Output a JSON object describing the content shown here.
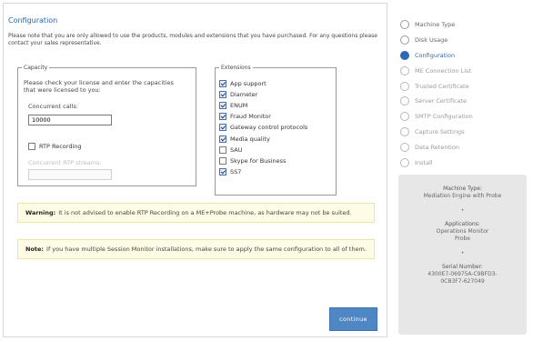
{
  "configuration": {
    "title": "Configuration",
    "intro": "Please note that you are only allowed to use the products, modules and extensions that you have purchased. For any questions please contact your sales representative."
  },
  "capacity": {
    "legend": "Capacity",
    "description": "Please check your license and enter the capacities that were licensed to you:",
    "concurrent_calls_label": "Concurrent calls:",
    "concurrent_calls_value": "10000",
    "rtp_recording_label": "RTP Recording",
    "rtp_recording_checked": false,
    "concurrent_rtp_label": "Concurrent RTP streams:"
  },
  "extensions": {
    "legend": "Extensions",
    "items": [
      {
        "label": "App support",
        "checked": true
      },
      {
        "label": "Diameter",
        "checked": true
      },
      {
        "label": "ENUM",
        "checked": true
      },
      {
        "label": "Fraud Monitor",
        "checked": true
      },
      {
        "label": "Gateway control protocols",
        "checked": true
      },
      {
        "label": "Media quality",
        "checked": true
      },
      {
        "label": "SAU",
        "checked": false
      },
      {
        "label": "Skype for Business",
        "checked": false
      },
      {
        "label": "SS7",
        "checked": true
      }
    ]
  },
  "warning": {
    "prefix": "Warning:",
    "text": "It is not advised to enable RTP Recording on a ME+Probe machine, as hardware may not be suited."
  },
  "note": {
    "prefix": "Note:",
    "text": "If you have multiple Session Monitor installations, make sure to apply the same configuration to all of them."
  },
  "continue_label": "continue",
  "steps": [
    {
      "label": "Machine Type",
      "state": "done"
    },
    {
      "label": "Disk Usage",
      "state": "done"
    },
    {
      "label": "Configuration",
      "state": "active"
    },
    {
      "label": "ME Connection List",
      "state": "pending"
    },
    {
      "label": "Trusted Certificate",
      "state": "pending"
    },
    {
      "label": "Server Certificate",
      "state": "pending"
    },
    {
      "label": "SMTP Configuration",
      "state": "pending"
    },
    {
      "label": "Capture Settings",
      "state": "pending"
    },
    {
      "label": "Data Retention",
      "state": "pending"
    },
    {
      "label": "Install",
      "state": "pending"
    }
  ],
  "info": {
    "machine_type_label": "Machine Type:",
    "machine_type_value": "Mediation Engine with Probe",
    "separator": "•",
    "applications_label": "Applications:",
    "applications": [
      "Operations Monitor",
      "Probe"
    ],
    "serial_label": "Serial Number:",
    "serial_lines": [
      "4300E7-06975A-C9BFD3-",
      "0CB3F7-627049"
    ]
  },
  "colors": {
    "accent": "#2f67b5",
    "button": "#4f86c4",
    "banner": "#fffce6",
    "info_panel": "#e7e7e7"
  }
}
